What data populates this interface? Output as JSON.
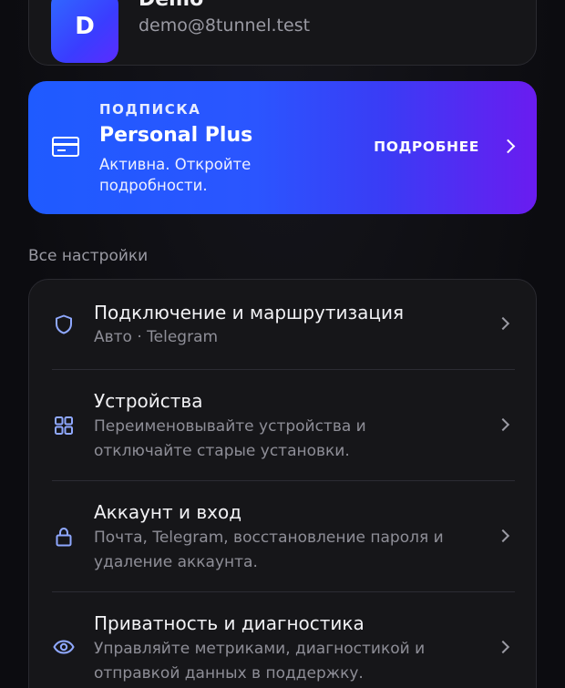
{
  "profile": {
    "avatar_letter": "D",
    "name": "Demo",
    "email": "demo@8tunnel.test"
  },
  "subscription": {
    "eyebrow": "ПОДПИСКА",
    "plan": "Personal Plus",
    "description": "Активна. Откройте подробности.",
    "more_label": "ПОДРОБНЕЕ"
  },
  "settings_section": {
    "label": "Все настройки",
    "items": [
      {
        "title": "Подключение и маршрутизация",
        "subtitle": "Авто · Telegram",
        "icon": "shield-icon"
      },
      {
        "title": "Устройства",
        "subtitle": "Переименовывайте устройства и отключайте старые установки.",
        "icon": "grid-icon"
      },
      {
        "title": "Аккаунт и вход",
        "subtitle": "Почта, Telegram, восстановление пароля и удаление аккаунта.",
        "icon": "lock-icon"
      },
      {
        "title": "Приватность и диагностика",
        "subtitle": "Управляйте метриками, диагностикой и отправкой данных в поддержку.",
        "icon": "eye-icon"
      }
    ]
  },
  "colors": {
    "accent_start": "#1f5bff",
    "accent_end": "#6a1cf0",
    "icon_tint": "#8fa8ff"
  }
}
